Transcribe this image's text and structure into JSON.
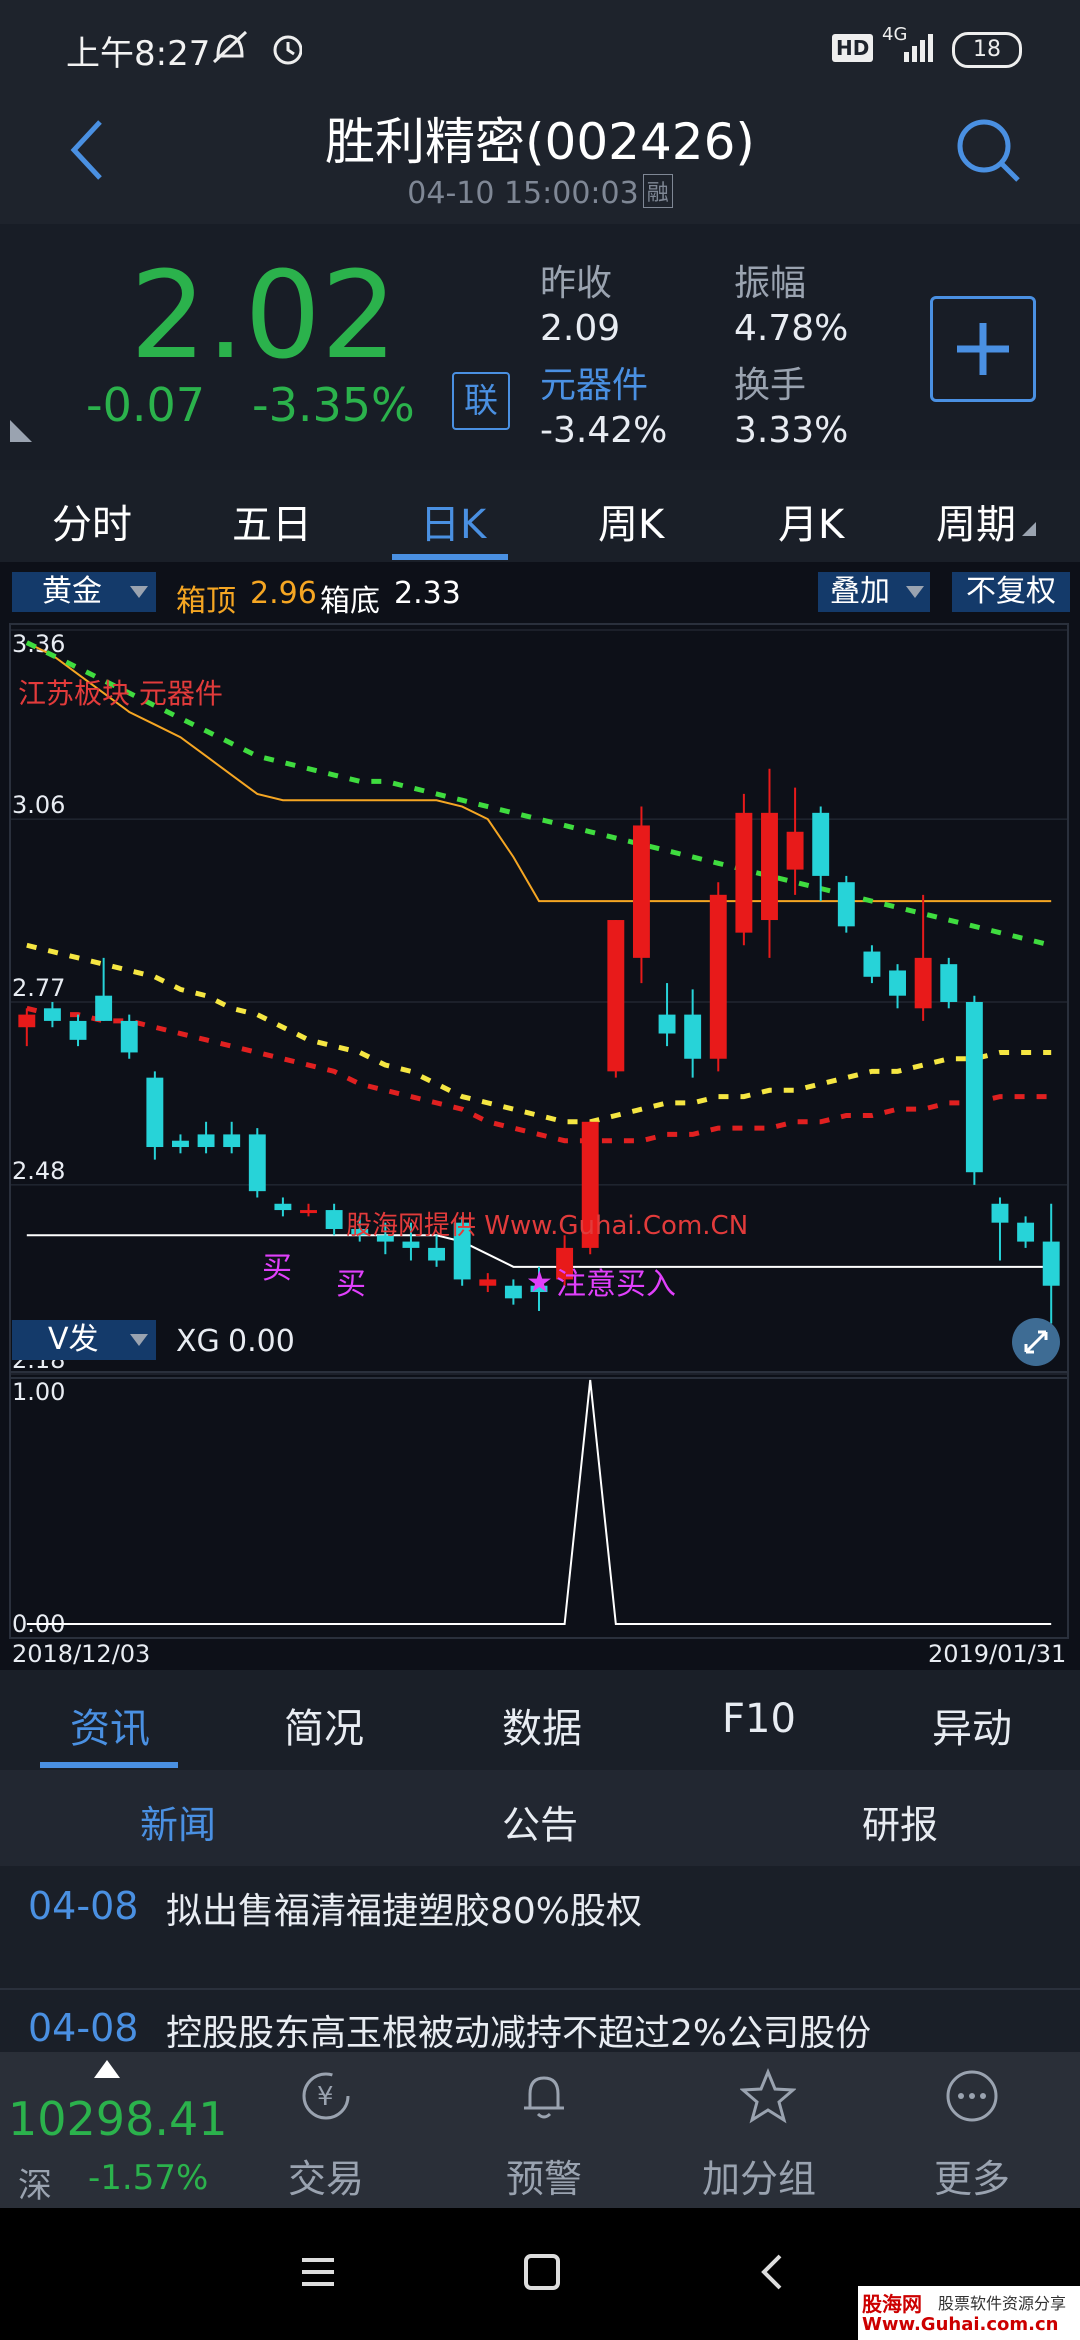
{
  "status": {
    "time": "上午8:27",
    "hd": "HD",
    "network": "4G",
    "battery": "18"
  },
  "header": {
    "title": "胜利精密(002426)",
    "datetime": "04-10 15:00:03",
    "tag": "融"
  },
  "quote": {
    "price": "2.02",
    "change": "-0.07",
    "change_pct": "-3.35%",
    "lian": "联",
    "prev_close_label": "昨收",
    "prev_close": "2.09",
    "amplitude_label": "振幅",
    "amplitude": "4.78%",
    "sector_label": "元器件",
    "sector_change": "-3.42%",
    "turnover_label": "换手",
    "turnover": "3.33%"
  },
  "period_tabs": [
    "分时",
    "五日",
    "日K",
    "周K",
    "月K",
    "周期"
  ],
  "active_tab": "日K",
  "chart": {
    "indicator_select": "黄金",
    "box_top_label": "箱顶",
    "box_top": "2.96",
    "box_bottom_label": "箱底",
    "box_bottom": "2.33",
    "overlay_btn": "叠加",
    "adjust_btn": "不复权",
    "sector_note": "江苏板块 元器件",
    "buy1": "买",
    "buy2": "买",
    "attention": "注意买入",
    "watermark": "股海网提供 Www.Guhai.Com.CN",
    "y_ticks": [
      "3.36",
      "3.06",
      "2.77",
      "2.48",
      "2.18"
    ],
    "vol_select": "V发",
    "xg_label": "XG",
    "xg_value": "0.00",
    "vol_ticks": [
      "1.00",
      "0.00"
    ],
    "date_start": "2018/12/03",
    "date_end": "2019/01/31"
  },
  "info_tabs": [
    "资讯",
    "简况",
    "数据",
    "F10",
    "异动"
  ],
  "sub_tabs": [
    "新闻",
    "公告",
    "研报"
  ],
  "news": [
    {
      "date": "04-08",
      "title": "拟出售福清福捷塑胶80%股权"
    },
    {
      "date": "04-08",
      "title": "控股股东高玉根被动减持不超过2%公司股份"
    }
  ],
  "index": {
    "value": "10298.41",
    "market": "深",
    "change": "-1.57%"
  },
  "bottom_nav": [
    "交易",
    "预警",
    "加分组",
    "更多"
  ],
  "watermark_corner": {
    "site": "股海网",
    "slogan": "股票软件资源分享",
    "url": "Www.Guhai.com.cn"
  },
  "colors": {
    "up": "#e23b3b",
    "down": "#2bb24c",
    "accent": "#4a90e2"
  },
  "chart_data": {
    "type": "candlestick",
    "ylim": [
      2.18,
      3.36
    ],
    "volume_ylim": [
      0,
      1
    ],
    "box_top": 2.96,
    "box_bottom": 2.33,
    "candles": [
      {
        "o": 2.73,
        "h": 2.76,
        "l": 2.7,
        "c": 2.75
      },
      {
        "o": 2.76,
        "h": 2.77,
        "l": 2.73,
        "c": 2.74
      },
      {
        "o": 2.74,
        "h": 2.75,
        "l": 2.7,
        "c": 2.71
      },
      {
        "o": 2.78,
        "h": 2.84,
        "l": 2.74,
        "c": 2.74
      },
      {
        "o": 2.74,
        "h": 2.75,
        "l": 2.68,
        "c": 2.69
      },
      {
        "o": 2.65,
        "h": 2.66,
        "l": 2.52,
        "c": 2.54
      },
      {
        "o": 2.55,
        "h": 2.56,
        "l": 2.53,
        "c": 2.54
      },
      {
        "o": 2.56,
        "h": 2.58,
        "l": 2.53,
        "c": 2.54
      },
      {
        "o": 2.56,
        "h": 2.58,
        "l": 2.53,
        "c": 2.54
      },
      {
        "o": 2.56,
        "h": 2.57,
        "l": 2.46,
        "c": 2.47
      },
      {
        "o": 2.45,
        "h": 2.46,
        "l": 2.43,
        "c": 2.44
      },
      {
        "o": 2.44,
        "h": 2.45,
        "l": 2.43,
        "c": 2.44
      },
      {
        "o": 2.44,
        "h": 2.45,
        "l": 2.4,
        "c": 2.41
      },
      {
        "o": 2.41,
        "h": 2.43,
        "l": 2.39,
        "c": 2.4
      },
      {
        "o": 2.4,
        "h": 2.42,
        "l": 2.37,
        "c": 2.39
      },
      {
        "o": 2.39,
        "h": 2.42,
        "l": 2.36,
        "c": 2.38
      },
      {
        "o": 2.38,
        "h": 2.4,
        "l": 2.35,
        "c": 2.36
      },
      {
        "o": 2.42,
        "h": 2.43,
        "l": 2.32,
        "c": 2.33
      },
      {
        "o": 2.32,
        "h": 2.34,
        "l": 2.31,
        "c": 2.33
      },
      {
        "o": 2.32,
        "h": 2.33,
        "l": 2.29,
        "c": 2.3
      },
      {
        "o": 2.32,
        "h": 2.35,
        "l": 2.28,
        "c": 2.31
      },
      {
        "o": 2.33,
        "h": 2.4,
        "l": 2.32,
        "c": 2.38
      },
      {
        "o": 2.38,
        "h": 2.58,
        "l": 2.37,
        "c": 2.58
      },
      {
        "o": 2.66,
        "h": 2.9,
        "l": 2.65,
        "c": 2.9
      },
      {
        "o": 2.84,
        "h": 3.08,
        "l": 2.8,
        "c": 3.05
      },
      {
        "o": 2.75,
        "h": 2.8,
        "l": 2.7,
        "c": 2.72
      },
      {
        "o": 2.75,
        "h": 2.79,
        "l": 2.65,
        "c": 2.68
      },
      {
        "o": 2.68,
        "h": 2.96,
        "l": 2.66,
        "c": 2.94
      },
      {
        "o": 2.88,
        "h": 3.1,
        "l": 2.86,
        "c": 3.07
      },
      {
        "o": 2.9,
        "h": 3.14,
        "l": 2.84,
        "c": 3.07
      },
      {
        "o": 2.98,
        "h": 3.11,
        "l": 2.94,
        "c": 3.04
      },
      {
        "o": 3.07,
        "h": 3.08,
        "l": 2.93,
        "c": 2.97
      },
      {
        "o": 2.96,
        "h": 2.97,
        "l": 2.88,
        "c": 2.89
      },
      {
        "o": 2.85,
        "h": 2.86,
        "l": 2.8,
        "c": 2.81
      },
      {
        "o": 2.82,
        "h": 2.83,
        "l": 2.76,
        "c": 2.78
      },
      {
        "o": 2.76,
        "h": 2.94,
        "l": 2.74,
        "c": 2.84
      },
      {
        "o": 2.83,
        "h": 2.84,
        "l": 2.76,
        "c": 2.77
      },
      {
        "o": 2.77,
        "h": 2.78,
        "l": 2.48,
        "c": 2.5
      },
      {
        "o": 2.45,
        "h": 2.46,
        "l": 2.36,
        "c": 2.42
      },
      {
        "o": 2.42,
        "h": 2.43,
        "l": 2.38,
        "c": 2.39
      },
      {
        "o": 2.39,
        "h": 2.45,
        "l": 2.26,
        "c": 2.32
      }
    ],
    "ma_green": [
      3.34,
      3.32,
      3.3,
      3.28,
      3.26,
      3.24,
      3.22,
      3.2,
      3.18,
      3.16,
      3.15,
      3.14,
      3.13,
      3.12,
      3.12,
      3.11,
      3.1,
      3.09,
      3.08,
      3.07,
      3.06,
      3.05,
      3.04,
      3.03,
      3.02,
      3.01,
      3.0,
      2.99,
      2.98,
      2.97,
      2.96,
      2.95,
      2.94,
      2.93,
      2.92,
      2.91,
      2.9,
      2.89,
      2.88,
      2.87,
      2.86
    ],
    "ma_orange": [
      3.34,
      3.32,
      3.29,
      3.26,
      3.23,
      3.21,
      3.19,
      3.16,
      3.13,
      3.1,
      3.09,
      3.09,
      3.09,
      3.09,
      3.09,
      3.09,
      3.09,
      3.08,
      3.06,
      3.0,
      2.93,
      2.93,
      2.93,
      2.93,
      2.93,
      2.93,
      2.93,
      2.93,
      2.93,
      2.93,
      2.93,
      2.93,
      2.93,
      2.93,
      2.93,
      2.93,
      2.93,
      2.93,
      2.93,
      2.93,
      2.93
    ],
    "ma_yellow": [
      2.86,
      2.85,
      2.84,
      2.83,
      2.82,
      2.81,
      2.79,
      2.78,
      2.76,
      2.75,
      2.73,
      2.71,
      2.7,
      2.69,
      2.67,
      2.66,
      2.64,
      2.62,
      2.61,
      2.6,
      2.59,
      2.58,
      2.58,
      2.59,
      2.6,
      2.61,
      2.61,
      2.62,
      2.62,
      2.63,
      2.63,
      2.64,
      2.65,
      2.66,
      2.66,
      2.67,
      2.68,
      2.68,
      2.69,
      2.69,
      2.69
    ],
    "ma_red": [
      2.76,
      2.75,
      2.75,
      2.74,
      2.74,
      2.73,
      2.72,
      2.71,
      2.7,
      2.69,
      2.68,
      2.67,
      2.66,
      2.64,
      2.63,
      2.62,
      2.61,
      2.6,
      2.58,
      2.57,
      2.56,
      2.55,
      2.55,
      2.55,
      2.55,
      2.56,
      2.56,
      2.57,
      2.57,
      2.57,
      2.58,
      2.58,
      2.59,
      2.59,
      2.6,
      2.6,
      2.61,
      2.61,
      2.62,
      2.62,
      2.62
    ],
    "support_line": [
      2.4,
      2.4,
      2.4,
      2.4,
      2.4,
      2.4,
      2.4,
      2.4,
      2.4,
      2.4,
      2.4,
      2.4,
      2.4,
      2.4,
      2.4,
      2.4,
      2.4,
      2.39,
      2.37,
      2.35,
      2.35,
      2.35,
      2.35,
      2.35,
      2.35,
      2.35,
      2.35,
      2.35,
      2.35,
      2.35,
      2.35,
      2.35,
      2.35,
      2.35,
      2.35,
      2.35,
      2.35,
      2.35,
      2.35,
      2.35,
      2.35
    ],
    "xg": [
      0,
      0,
      0,
      0,
      0,
      0,
      0,
      0,
      0,
      0,
      0,
      0,
      0,
      0,
      0,
      0,
      0,
      0,
      0,
      0,
      0,
      0,
      1,
      0,
      0,
      0,
      0,
      0,
      0,
      0,
      0,
      0,
      0,
      0,
      0,
      0,
      0,
      0,
      0,
      0,
      0
    ]
  }
}
